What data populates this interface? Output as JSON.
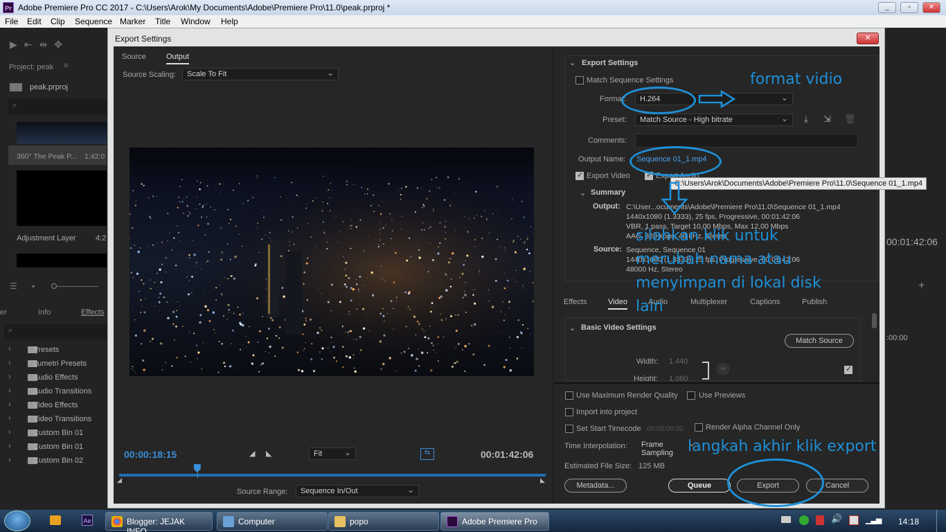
{
  "window": {
    "title": "Adobe Premiere Pro CC 2017 - C:\\Users\\Arok\\My Documents\\Adobe\\Premiere Pro\\11.0\\peak.prproj *",
    "logo": "Pr"
  },
  "menu": [
    "File",
    "Edit",
    "Clip",
    "Sequence",
    "Marker",
    "Title",
    "Window",
    "Help"
  ],
  "project": {
    "title": "Project: peak",
    "file": "peak.prproj",
    "items": [
      {
        "name": "360° The Peak P...",
        "duration": "1:42:0"
      },
      {
        "name": "Adjustment Layer",
        "duration": "4:2"
      }
    ]
  },
  "effects_panel": {
    "tabs": [
      "er",
      "Info",
      "Effects"
    ],
    "items": [
      "Presets",
      "Lumetri Presets",
      "Audio Effects",
      "Audio Transitions",
      "Video Effects",
      "Video Transitions",
      "Custom Bin 01",
      "Custom Bin 01",
      "Custom Bin 02"
    ]
  },
  "dialog": {
    "title": "Export Settings",
    "close": "✕",
    "tabs": [
      "Source",
      "Output"
    ],
    "source_scaling_label": "Source Scaling:",
    "source_scaling_value": "Scale To Fit",
    "timecode_current": "00:00:18:15",
    "timecode_end": "00:01:42:06",
    "fit_value": "Fit",
    "playhead_fraction": 0.18,
    "source_range_label": "Source Range:",
    "source_range_value": "Sequence In/Out"
  },
  "export_settings": {
    "header": "Export Settings",
    "match_sequence": "Match Sequence Settings",
    "format_label": "Format:",
    "format_value": "H.264",
    "preset_label": "Preset:",
    "preset_value": "Match Source - High bitrate",
    "comments_label": "Comments:",
    "output_name_label": "Output Name:",
    "output_name_value": "Sequence 01_1.mp4",
    "export_video": "Export Video",
    "export_audio": "Export Audio",
    "tooltip": "C:\\Users\\Arok\\Documents\\Adobe\\Premiere Pro\\11.0\\Sequence 01_1.mp4",
    "summary_header": "Summary",
    "output_label": "Output:",
    "output_lines": [
      "C:\\User...ocuments\\Adobe\\Premiere Pro\\11.0\\Sequence 01_1.mp4",
      "1440x1080 (1.3333), 25 fps, Progressive, 00:01:42:06",
      "VBR, 1 pass, Target 10,00 Mbps, Max 12,00 Mbps",
      "AAC, 320 kbps, 48 kHz, Stereo"
    ],
    "source_label": "Source:",
    "source_lines": [
      "Sequence, Sequence 01",
      "1440x1080 (1.3333), 25 fps, Progressive, 00:01:42:06",
      "48000 Hz, Stereo"
    ]
  },
  "settings_tabs": [
    "Effects",
    "Video",
    "Audio",
    "Multiplexer",
    "Captions",
    "Publish"
  ],
  "basic_video": {
    "header": "Basic Video Settings",
    "match_source": "Match Source",
    "width_label": "Width:",
    "width_value": "1.440",
    "height_label": "Height:",
    "height_value": "1.080"
  },
  "bottom_options": {
    "max_render": "Use Maximum Render Quality",
    "use_previews": "Use Previews",
    "import_project": "Import into project",
    "set_start_timecode": "Set Start Timecode",
    "start_timecode_value": "00:00:00:00",
    "render_alpha": "Render Alpha Channel Only",
    "time_interp_label": "Time Interpolation:",
    "time_interp_value": "Frame Sampling",
    "est_size_label": "Estimated File Size:",
    "est_size_value": "125 MB",
    "metadata": "Metadata...",
    "queue": "Queue",
    "export": "Export",
    "cancel": "Cancel"
  },
  "right_edge": {
    "timecode": "00:01:42:06",
    "timecode2": ":00:00"
  },
  "annotations": {
    "format": "format vidio",
    "rename": [
      "silahkan klik untuk",
      "merubah nama atau",
      "menyimpan di lokal disk",
      "lain"
    ],
    "export": "langkah akhir klik export"
  },
  "taskbar": {
    "items": [
      "Blogger: JEJAK INFO ...",
      "Computer",
      "popo",
      "Adobe Premiere Pro ..."
    ],
    "clock": "14:18",
    "ae": "Ae"
  },
  "colors": {
    "accent": "#1e90d8",
    "timecode": "#3b8fd9",
    "link": "#4aa3f0"
  }
}
